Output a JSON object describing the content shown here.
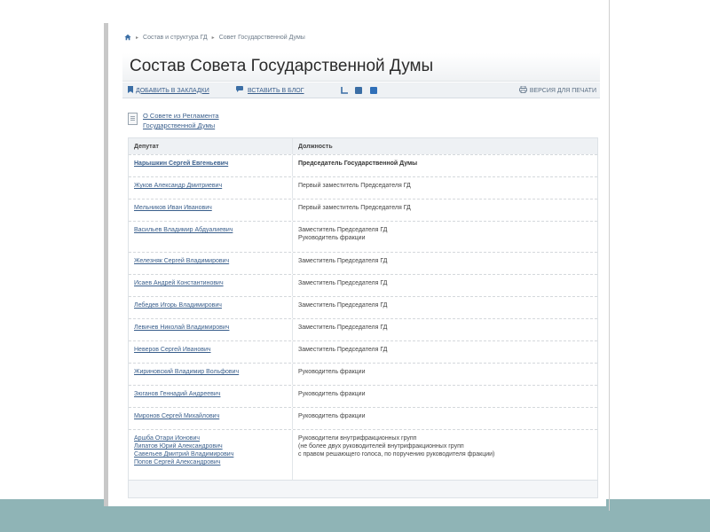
{
  "breadcrumb": {
    "items": [
      "Состав и структура ГД",
      "Совет Государственной Думы"
    ]
  },
  "page_title": "Состав Совета Государственной Думы",
  "toolbar": {
    "bookmark_label": "Добавить в закладки",
    "blog_label": "Вставить в блог",
    "print_label": "Версия для печати"
  },
  "reg_link": {
    "line1": "О Совете из Регламента",
    "line2": "Государственной Думы"
  },
  "table": {
    "headers": {
      "deputy": "Депутат",
      "position": "Должность"
    },
    "rows": [
      {
        "name": "Нарышкин Сергей Евгеньевич",
        "pos1": "Председатель Государственной Думы"
      },
      {
        "name": "Жуков Александр Дмитриевич",
        "pos1": "Первый заместитель Председателя ГД"
      },
      {
        "name": "Мельников Иван Иванович",
        "pos1": "Первый заместитель Председателя ГД"
      },
      {
        "name": "Васильев Владимир Абдуалиевич",
        "pos1": "Заместитель Председателя ГД",
        "pos2": "Руководитель фракции"
      },
      {
        "name": "Железняк Сергей Владимирович",
        "pos1": "Заместитель Председателя ГД"
      },
      {
        "name": "Исаев Андрей Константинович",
        "pos1": "Заместитель Председателя ГД"
      },
      {
        "name": "Лебедев Игорь Владимирович",
        "pos1": "Заместитель Председателя ГД"
      },
      {
        "name": "Левичев Николай Владимирович",
        "pos1": "Заместитель Председателя ГД"
      },
      {
        "name": "Неверов Сергей Иванович",
        "pos1": "Заместитель Председателя ГД"
      },
      {
        "name": "Жириновский Владимир Вольфович",
        "pos1": "Руководитель фракции"
      },
      {
        "name": "Зюганов Геннадий Андреевич",
        "pos1": "Руководитель фракции"
      },
      {
        "name": "Миронов Сергей Михайлович",
        "pos1": "Руководитель фракции"
      }
    ],
    "group_row": {
      "names": [
        "Аршба Отари Ионович",
        "Липатов Юрий Александрович",
        "Савельев Дмитрий Владимирович",
        "Попов Сергей Александрович"
      ],
      "pos_lines": [
        "Руководители внутрифракционных групп",
        "(не более двух руководителей внутрифракционных групп",
        "с правом решающего голоса, по поручению руководителя фракции)"
      ]
    }
  },
  "colors": {
    "link": "#3a5f8c",
    "bottom_band": "#8fb4b6"
  }
}
